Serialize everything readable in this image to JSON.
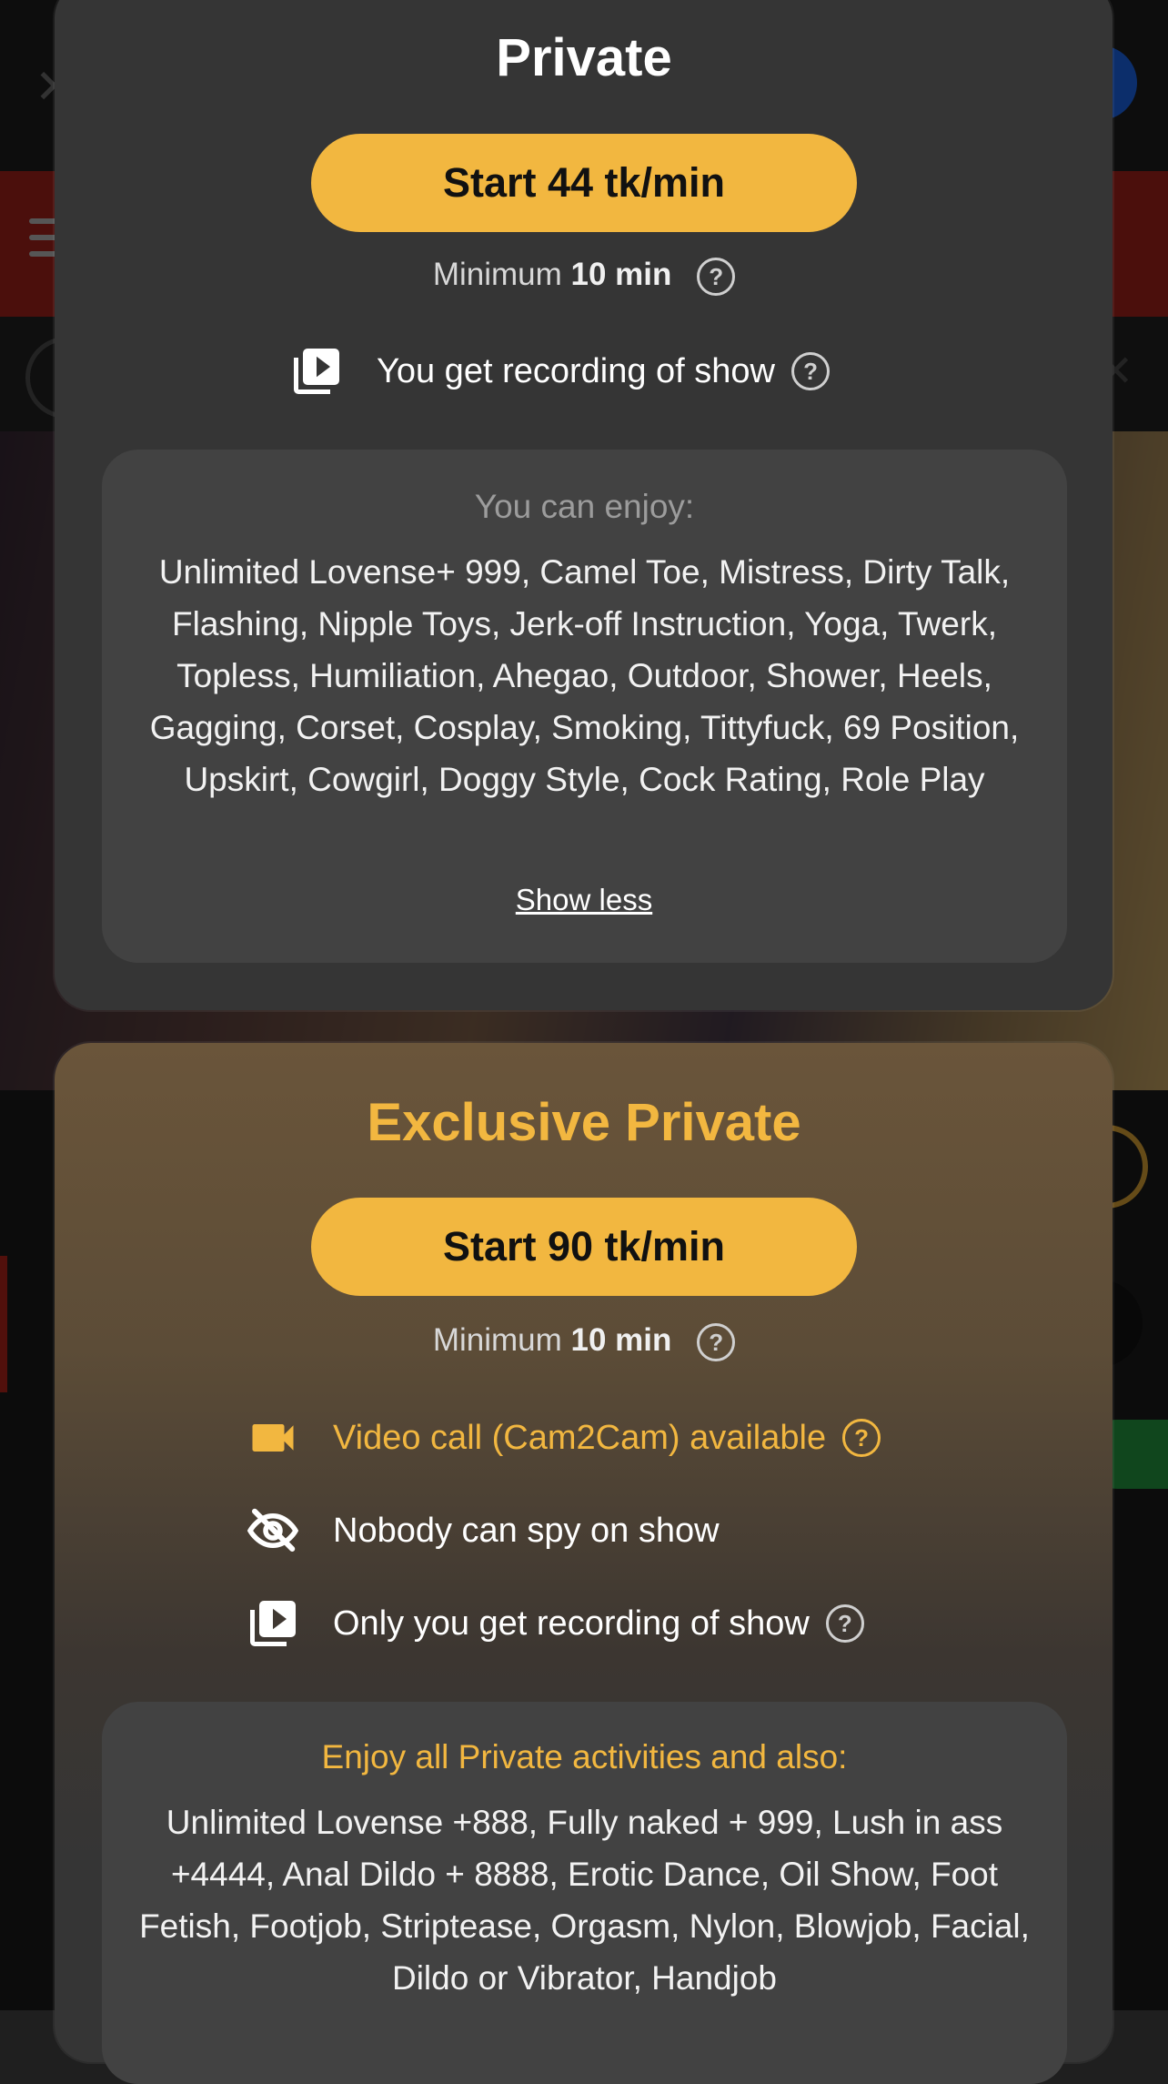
{
  "private": {
    "title": "Private",
    "cta_label": "Start 44 tk/min",
    "minimum_prefix": "Minimum",
    "minimum_value": "10 min",
    "feature_recording": "You get recording of show",
    "enjoy_title": "You can enjoy:",
    "enjoy_list": "Unlimited Lovense+ 999, Camel Toe, Mistress, Dirty Talk, Flashing, Nipple Toys, Jerk-off Instruction, Yoga, Twerk, Topless, Humiliation, Ahegao, Outdoor, Shower, Heels, Gagging, Corset, Cosplay, Smoking, Tittyfuck, 69 Position, Upskirt, Cowgirl, Doggy Style, Cock Rating, Role Play",
    "show_less": "Show less"
  },
  "exclusive": {
    "title": "Exclusive Private",
    "cta_label": "Start 90 tk/min",
    "minimum_prefix": "Minimum",
    "minimum_value": "10 min",
    "feature_cam": "Video call (Cam2Cam) available",
    "feature_spy": "Nobody can spy on show",
    "feature_recording": "Only you get recording of show",
    "enjoy_title": "Enjoy all Private activities and also:",
    "enjoy_list": "Unlimited Lovense +888, Fully naked + 999, Lush in ass +4444, Anal Dildo + 8888, Erotic Dance, Oil Show, Foot Fetish, Footjob, Striptease, Orgasm, Nylon, Blowjob, Facial, Dildo or Vibrator, Handjob"
  },
  "icons": {
    "help": "?",
    "recording": "video-library-icon",
    "camera": "videocam-icon",
    "no_spy": "eye-off-icon"
  },
  "colors": {
    "accent": "#f2b740",
    "card": "#353535",
    "inner": "#424242"
  }
}
